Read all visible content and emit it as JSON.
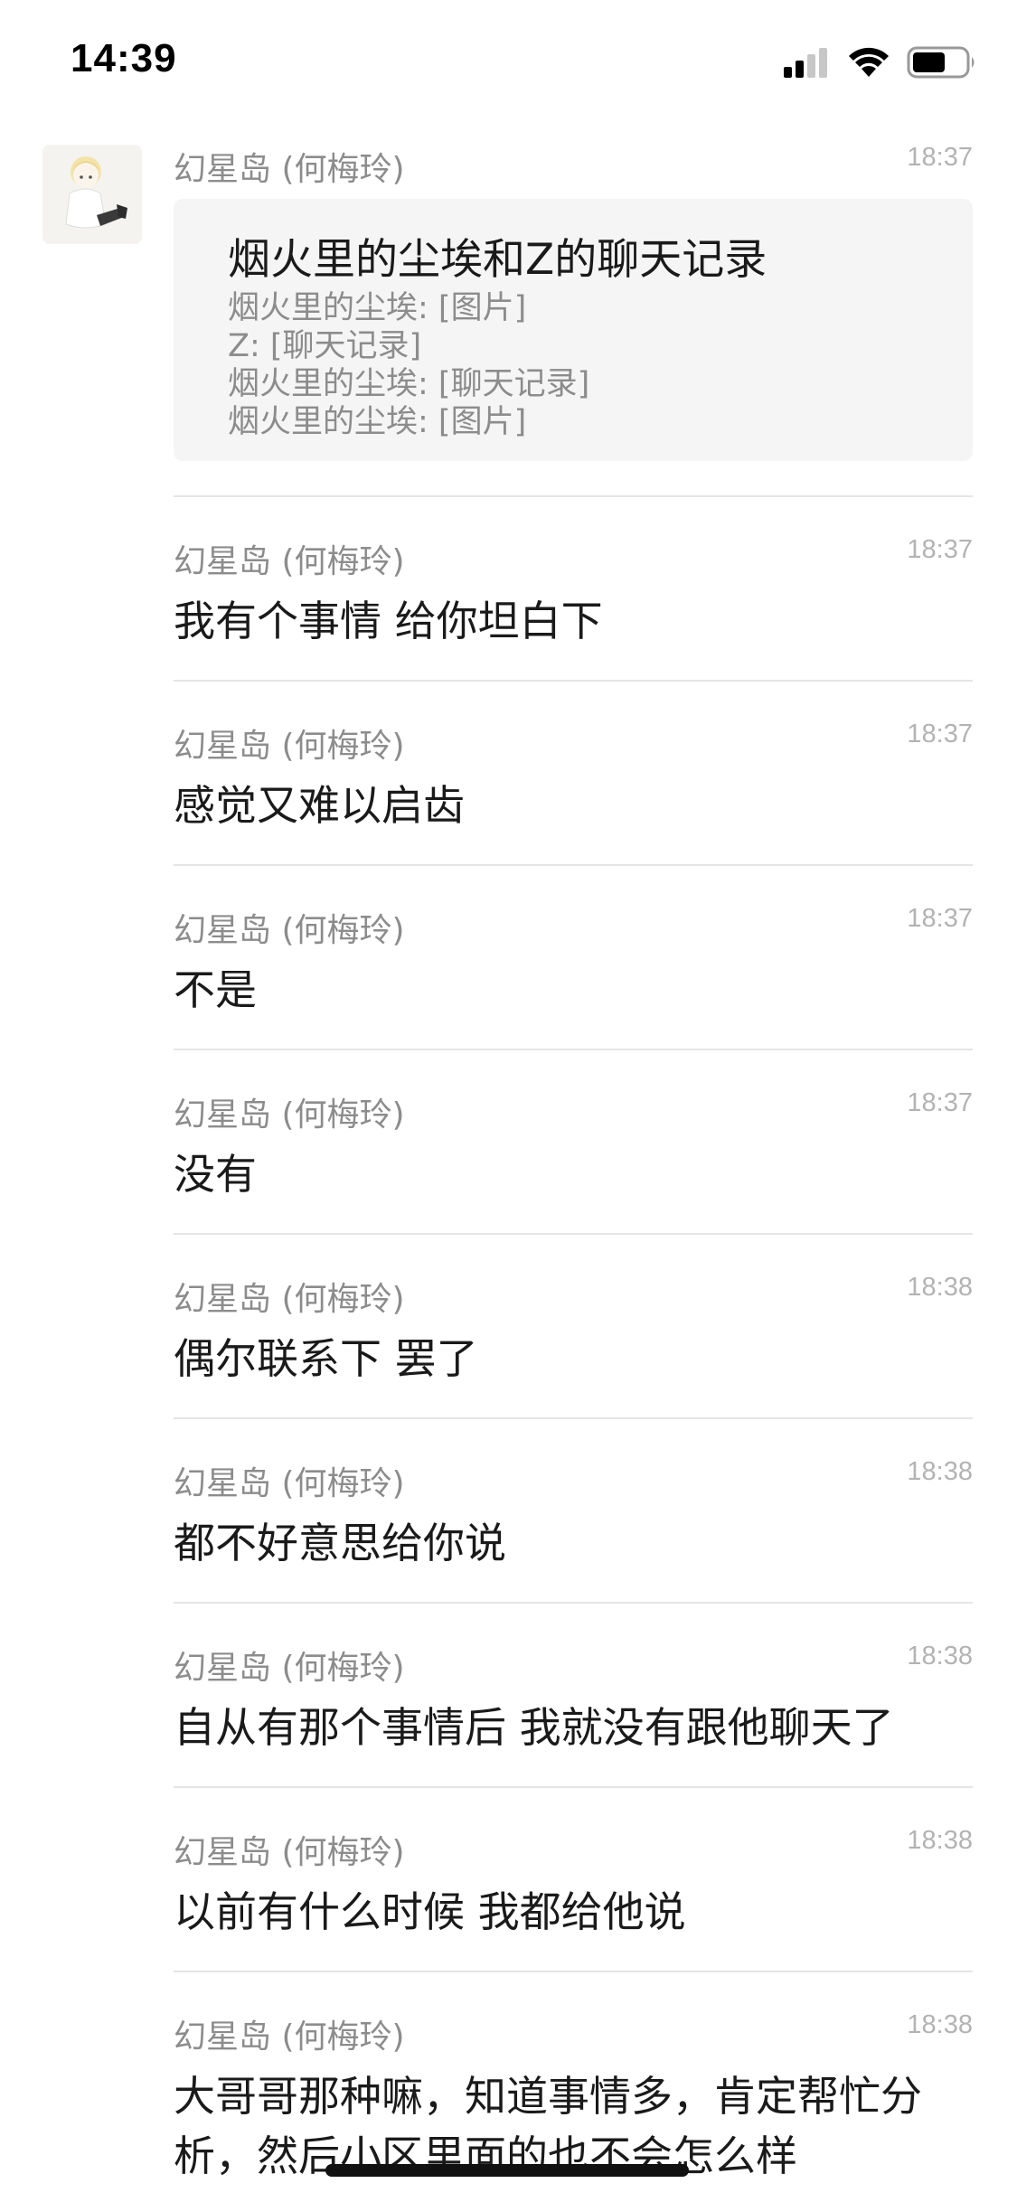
{
  "status_bar": {
    "time": "14:39",
    "icons": [
      "signal-icon",
      "wifi-icon",
      "battery-icon"
    ]
  },
  "conversation": {
    "sender": "幻星岛 (何梅玲)",
    "history_card": {
      "title": "烟火里的尘埃和Z的聊天记录",
      "lines": [
        "烟火里的尘埃: [图片]",
        "Z: [聊天记录]",
        "烟火里的尘埃: [聊天记录]",
        "烟火里的尘埃: [图片]"
      ],
      "time": "18:37"
    },
    "messages": [
      {
        "sender": "幻星岛 (何梅玲)",
        "time": "18:37",
        "text": "我有个事情 给你坦白下"
      },
      {
        "sender": "幻星岛 (何梅玲)",
        "time": "18:37",
        "text": "感觉又难以启齿"
      },
      {
        "sender": "幻星岛 (何梅玲)",
        "time": "18:37",
        "text": "不是"
      },
      {
        "sender": "幻星岛 (何梅玲)",
        "time": "18:37",
        "text": "没有"
      },
      {
        "sender": "幻星岛 (何梅玲)",
        "time": "18:38",
        "text": "偶尔联系下 罢了"
      },
      {
        "sender": "幻星岛 (何梅玲)",
        "time": "18:38",
        "text": "都不好意思给你说"
      },
      {
        "sender": "幻星岛 (何梅玲)",
        "time": "18:38",
        "text": "自从有那个事情后 我就没有跟他聊天了"
      },
      {
        "sender": "幻星岛 (何梅玲)",
        "time": "18:38",
        "text": "以前有什么时候 我都给他说"
      },
      {
        "sender": "幻星岛 (何梅玲)",
        "time": "18:38",
        "text": "大哥哥那种嘛，知道事情多，肯定帮忙分析，然后小区里面的也不会怎么样"
      }
    ]
  },
  "colors": {
    "sender": "#8c8c8c",
    "time": "#b3b3b3",
    "text": "#1a1a1a",
    "card_bg": "#f5f5f5",
    "divider": "#e5e5e5"
  }
}
